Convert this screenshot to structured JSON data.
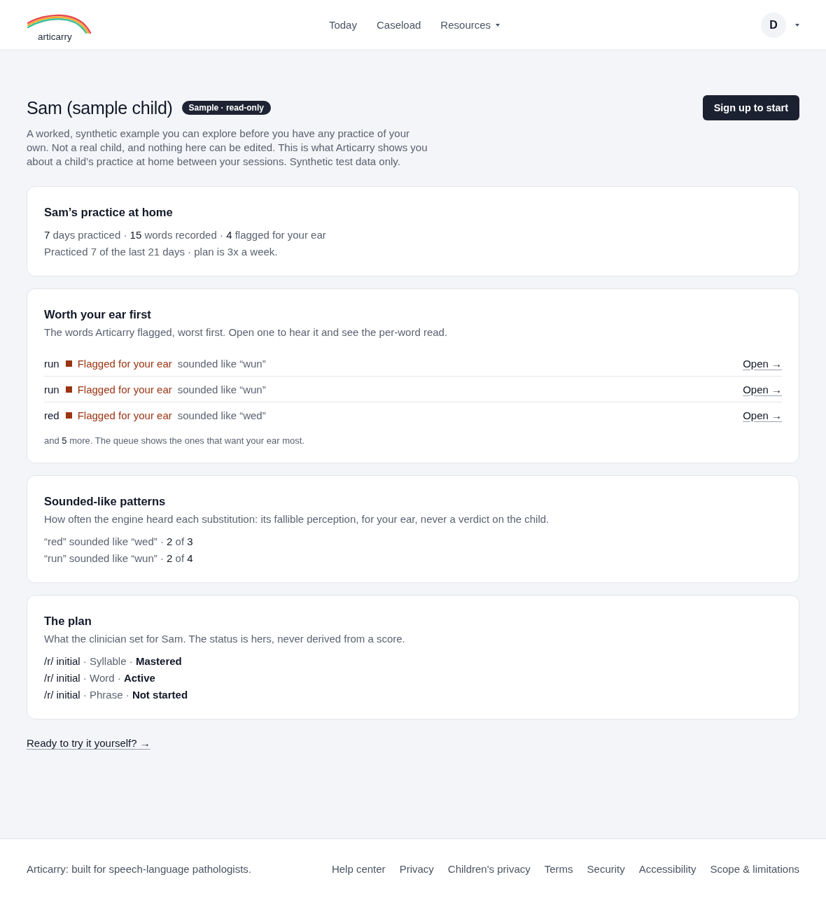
{
  "header": {
    "logo_text": "articarry",
    "nav": [
      {
        "label": "Today",
        "has_menu": false
      },
      {
        "label": "Caseload",
        "has_menu": false
      },
      {
        "label": "Resources",
        "has_menu": true
      }
    ],
    "avatar": {
      "initial": "D",
      "has_menu": true
    }
  },
  "page": {
    "title": "Sam (sample child)",
    "badge": "Sample · read-only",
    "primary_button": "Sign up to start",
    "description": "A worked, synthetic example you can explore before you have any practice of your own. Not a real child, and nothing here can be edited. This is what Articarry shows you about a child’s practice at home between your sessions. Synthetic test data only."
  },
  "practice": {
    "title": "Sam’s practice at home",
    "lines": [
      "**7** days practiced · **15** words recorded · **4** flagged for your ear",
      "Practiced 7 of the last 21 days · plan is 3x a week."
    ]
  },
  "flagged": {
    "title": "Worth your ear first",
    "description": "The words Articarry flagged, worst first. Open one to hear it and see the per-word read.",
    "items": [
      {
        "word": "run",
        "flag": "Flagged for your ear",
        "sounded_like": "sounded like “wun”",
        "action": "Open →"
      },
      {
        "word": "run",
        "flag": "Flagged for your ear",
        "sounded_like": "sounded like “wun”",
        "action": "Open →"
      },
      {
        "word": "red",
        "flag": "Flagged for your ear",
        "sounded_like": "sounded like “wed”",
        "action": "Open →"
      }
    ],
    "more": "and **5** more. The queue shows the ones that want your ear most."
  },
  "patterns": {
    "title": "Sounded-like patterns",
    "description": "How often the engine heard each substitution: its fallible perception, for your ear, never a verdict on the child.",
    "items": [
      "“red” sounded like “wed” · **2** of **3**",
      "“run” sounded like “wun” · **2** of **4**"
    ]
  },
  "plan": {
    "title": "The plan",
    "description": "What the clinician set for Sam. The status is hers, never derived from a score.",
    "separator": "·",
    "items": [
      {
        "target": "/r/ initial",
        "level": "Syllable",
        "status": "Mastered"
      },
      {
        "target": "/r/ initial",
        "level": "Word",
        "status": "Active"
      },
      {
        "target": "/r/ initial",
        "level": "Phrase",
        "status": "Not started"
      }
    ]
  },
  "cta_link": "Ready to try it yourself? →",
  "footer": {
    "tagline": "Articarry: built for speech-language pathologists.",
    "links": [
      "Help center",
      "Privacy",
      "Children's privacy",
      "Terms",
      "Security",
      "Accessibility",
      "Scope & limitations"
    ]
  }
}
